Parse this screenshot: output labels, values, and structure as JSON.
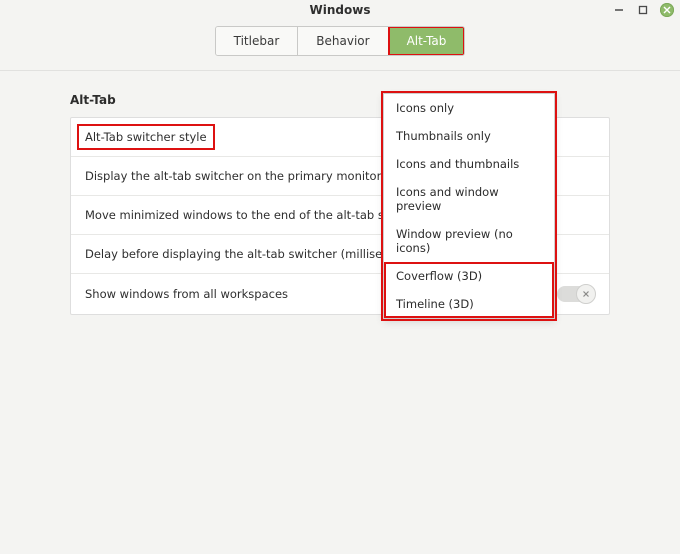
{
  "window": {
    "title": "Windows"
  },
  "tabs": {
    "titlebar": "Titlebar",
    "behavior": "Behavior",
    "alttab": "Alt-Tab"
  },
  "section": {
    "heading": "Alt-Tab"
  },
  "rows": {
    "style": "Alt-Tab switcher style",
    "primary": "Display the alt-tab switcher on the primary monitor instead of the",
    "minimized": "Move minimized windows to the end of the alt-tab switcher",
    "delay": "Delay before displaying the alt-tab switcher (milliseconds)",
    "workspaces": "Show windows from all workspaces"
  },
  "menu": {
    "icons_only": "Icons only",
    "thumbs_only": "Thumbnails only",
    "icons_thumbs": "Icons and thumbnails",
    "icons_preview": "Icons and window preview",
    "win_preview": "Window preview (no icons)",
    "coverflow": "Coverflow (3D)",
    "timeline": "Timeline (3D)"
  },
  "toggle": {
    "workspaces_on": false
  }
}
